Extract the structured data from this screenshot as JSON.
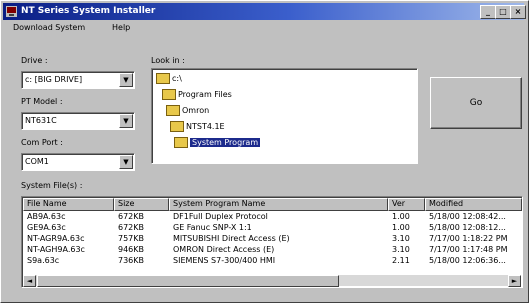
{
  "window": {
    "title": "NT Series System Installer",
    "min": "_",
    "max": "□",
    "close": "×"
  },
  "menu": {
    "download_system": "Download System",
    "help": "Help"
  },
  "drive": {
    "label": "Drive :",
    "value": "c: [BIG DRIVE]"
  },
  "pt_model": {
    "label": "PT Model :",
    "value": "NT631C"
  },
  "com_port": {
    "label": "Com Port :",
    "value": "COM1"
  },
  "look_in": {
    "label": "Look in :",
    "folders": [
      {
        "name": "c:\\"
      },
      {
        "name": "Program Files"
      },
      {
        "name": "Omron"
      },
      {
        "name": "NTST4.1E"
      },
      {
        "name": "System Program",
        "selected": true
      }
    ]
  },
  "go_button": "Go",
  "system_files": {
    "label": "System File(s) :",
    "columns": [
      "File Name",
      "Size",
      "System Program Name",
      "Ver",
      "Modified"
    ],
    "rows": [
      [
        "AB9A.63c",
        "672KB",
        "DF1Full Duplex Protocol",
        "1.00",
        "5/18/00 12:08:42..."
      ],
      [
        "GE9A.63c",
        "672KB",
        "GE Fanuc SNP-X 1:1",
        "1.00",
        "5/18/00 12:08:12..."
      ],
      [
        "NT-AGR9A.63c",
        "757KB",
        "MITSUBISHI Direct Access (E)",
        "3.10",
        "7/17/00 1:18:22 PM"
      ],
      [
        "NT-AGH9A.63c",
        "946KB",
        "OMRON Direct Access (E)",
        "3.10",
        "7/17/00 1:17:48 PM"
      ],
      [
        "S9a.63c",
        "736KB",
        "SIEMENS S7-300/400 HMI",
        "2.11",
        "5/18/00 12:06:36..."
      ]
    ]
  }
}
